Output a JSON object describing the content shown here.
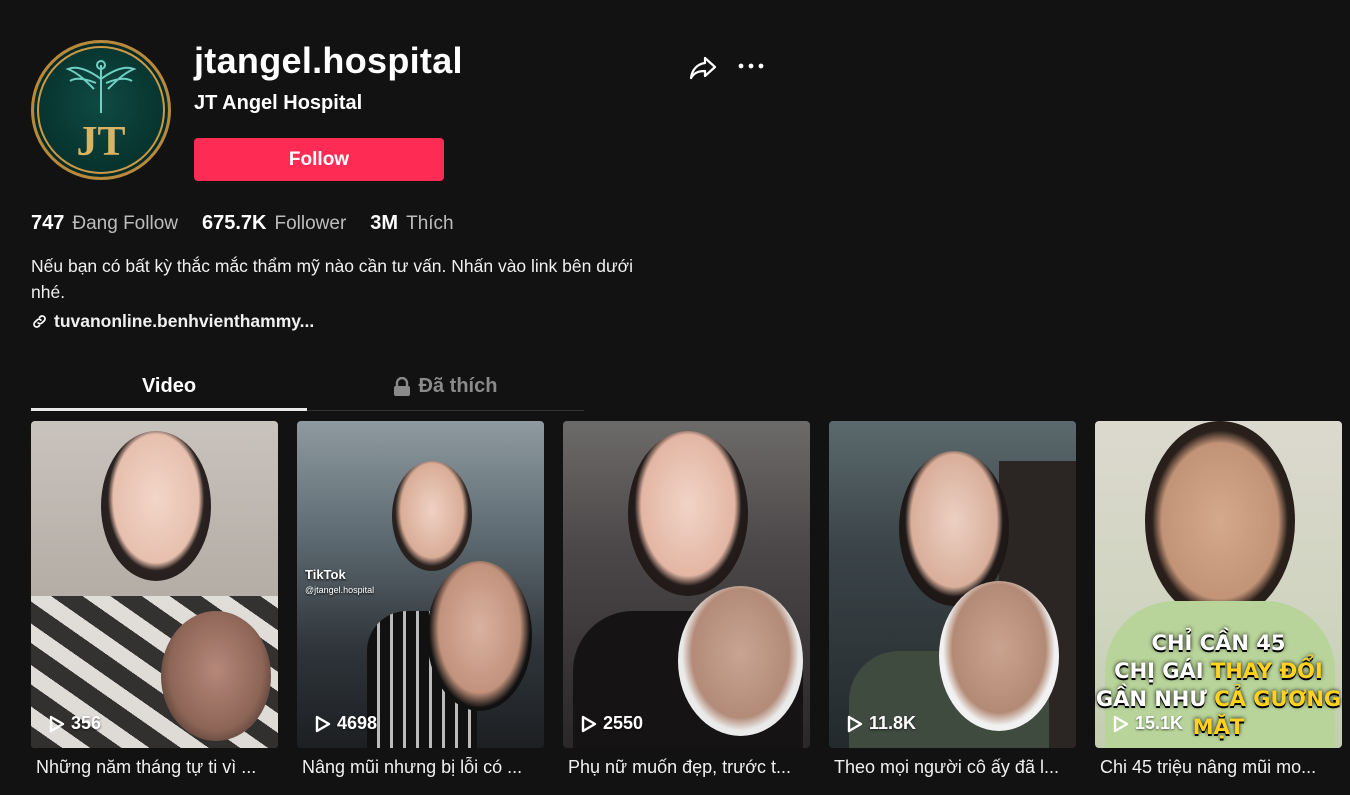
{
  "profile": {
    "username": "jtangel.hospital",
    "nickname": "JT Angel Hospital",
    "avatar_text": "JT",
    "follow_label": "Follow",
    "bio": "Nếu bạn có bất kỳ thắc mắc thẩm mỹ nào cần tư vấn. Nhấn vào link bên dưới nhé.",
    "link": "tuvanonline.benhvienthammy..."
  },
  "icons": {
    "share": "share-icon",
    "more": "more-icon",
    "link": "link-icon",
    "lock": "lock-icon",
    "play": "play-icon"
  },
  "stats": [
    {
      "value": "747",
      "label": "Đang Follow"
    },
    {
      "value": "675.7K",
      "label": "Follower"
    },
    {
      "value": "3M",
      "label": "Thích"
    }
  ],
  "tabs": [
    {
      "label": "Video",
      "active": true
    },
    {
      "label": "Đã thích",
      "active": false,
      "locked": true
    }
  ],
  "videos": [
    {
      "views": "356",
      "caption": "Những năm tháng tự ti vì ..."
    },
    {
      "views": "4698",
      "caption": "Nâng mũi nhưng bị lỗi có ...",
      "watermark": "TikTok",
      "handle": "@jtangel.hospital"
    },
    {
      "views": "2550",
      "caption": "Phụ nữ muốn đẹp, trước t..."
    },
    {
      "views": "11.8K",
      "caption": "Theo mọi người cô ấy đã l..."
    },
    {
      "views": "15.1K",
      "caption": "Chi 45 triệu nâng mũi mo...",
      "overlay_lines": [
        "CHỈ CẦN 45",
        "CHỊ GÁI",
        "THAY ĐỔI",
        "GẦN NHƯ",
        "CẢ GƯƠNG MẶT"
      ]
    }
  ],
  "colors": {
    "background": "#121212",
    "accent": "#fe2c55",
    "avatar_ring": "#b8893a",
    "avatar_bg": "#083530"
  }
}
